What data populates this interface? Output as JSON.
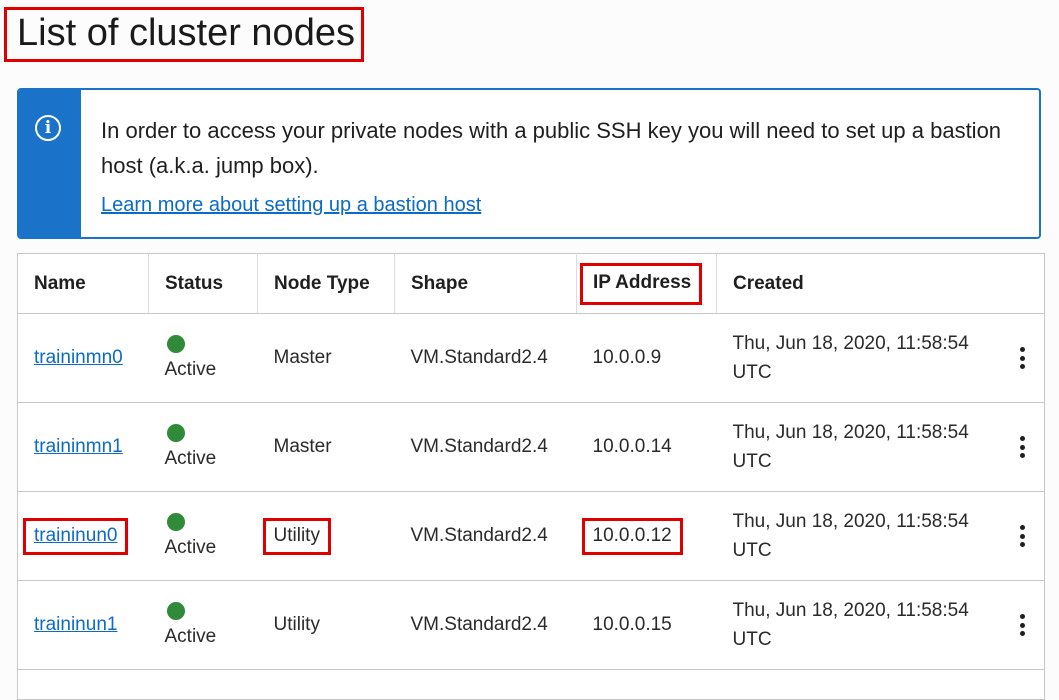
{
  "page": {
    "title": "List of cluster nodes"
  },
  "banner": {
    "message": "In order to access your private nodes with a public SSH key you will need to set up a bastion host (a.k.a. jump box).",
    "link": "Learn more about setting up a bastion host",
    "icon": "info-icon"
  },
  "table": {
    "columns": [
      "Name",
      "Status",
      "Node Type",
      "Shape",
      "IP Address",
      "Created"
    ],
    "rows": [
      {
        "name": "traininmn0",
        "status": "Active",
        "node_type": "Master",
        "shape": "VM.Standard2.4",
        "ip": "10.0.0.9",
        "created": "Thu, Jun 18, 2020, 11:58:54 UTC"
      },
      {
        "name": "traininmn1",
        "status": "Active",
        "node_type": "Master",
        "shape": "VM.Standard2.4",
        "ip": "10.0.0.14",
        "created": "Thu, Jun 18, 2020, 11:58:54 UTC"
      },
      {
        "name": "traininun0",
        "status": "Active",
        "node_type": "Utility",
        "shape": "VM.Standard2.4",
        "ip": "10.0.0.12",
        "created": "Thu, Jun 18, 2020, 11:58:54 UTC"
      },
      {
        "name": "traininun1",
        "status": "Active",
        "node_type": "Utility",
        "shape": "VM.Standard2.4",
        "ip": "10.0.0.15",
        "created": "Thu, Jun 18, 2020, 11:58:54 UTC"
      }
    ]
  },
  "colors": {
    "accent": "#1a73c8",
    "link": "#0b6bc7",
    "status_active": "#2f8a3a",
    "highlight": "#e00000"
  }
}
